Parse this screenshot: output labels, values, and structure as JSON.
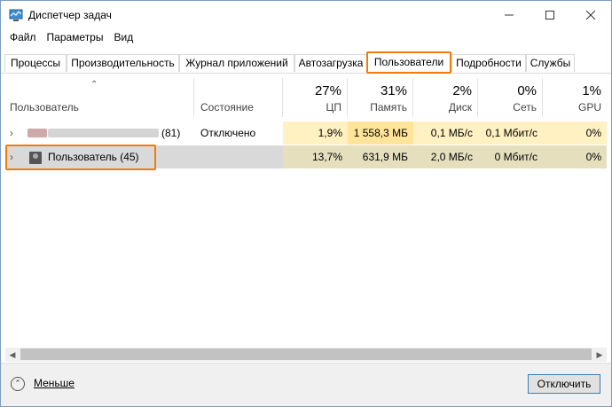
{
  "window": {
    "title": "Диспетчер задач",
    "minimize_icon": "minimize-icon",
    "maximize_icon": "maximize-icon",
    "close_icon": "close-icon"
  },
  "menu": [
    "Файл",
    "Параметры",
    "Вид"
  ],
  "tabs": [
    "Процессы",
    "Производительность",
    "Журнал приложений",
    "Автозагрузка",
    "Пользователи",
    "Подробности",
    "Службы"
  ],
  "active_tab": "Пользователи",
  "columns": {
    "user": "Пользователь",
    "status": "Состояние",
    "cpu": {
      "pct": "27%",
      "label": "ЦП"
    },
    "memory": {
      "pct": "31%",
      "label": "Память"
    },
    "disk": {
      "pct": "2%",
      "label": "Диск"
    },
    "network": {
      "pct": "0%",
      "label": "Сеть"
    },
    "gpu": {
      "pct": "1%",
      "label": "GPU"
    }
  },
  "rows": [
    {
      "name": "(81)",
      "status": "Отключено",
      "cpu": "1,9%",
      "memory": "1 558,3 МБ",
      "disk": "0,1 МБ/с",
      "network": "0,1 Мбит/с",
      "gpu": "0%"
    },
    {
      "name": "Пользователь (45)",
      "status": "",
      "cpu": "13,7%",
      "memory": "631,9 МБ",
      "disk": "2,0 МБ/с",
      "network": "0 Мбит/с",
      "gpu": "0%"
    }
  ],
  "footer": {
    "fewer_label": "Меньше",
    "disconnect_label": "Отключить"
  },
  "colors": {
    "accent": "#f07d0b",
    "heat_light": "#fff4c4",
    "heat_mid": "#ffe9a8",
    "row_selected": "#d9d9d9"
  }
}
